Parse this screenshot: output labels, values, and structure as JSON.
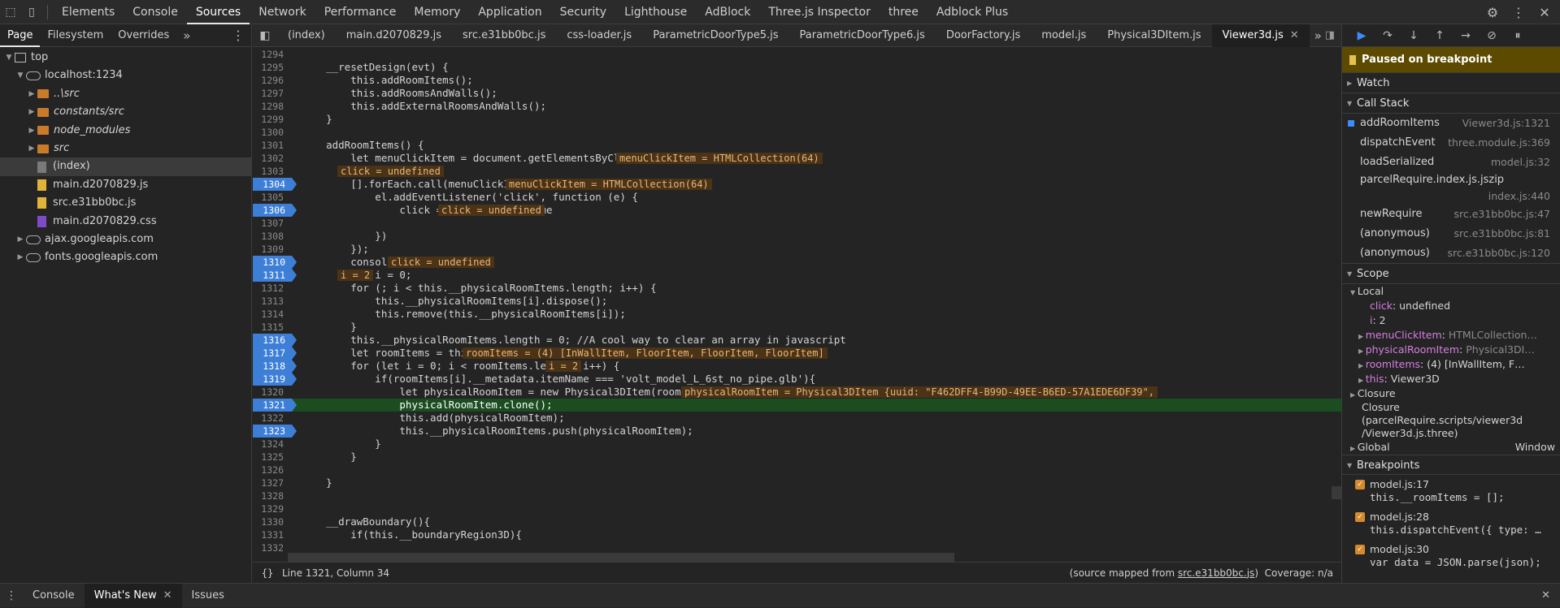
{
  "top_tabs": [
    "Elements",
    "Console",
    "Sources",
    "Network",
    "Performance",
    "Memory",
    "Application",
    "Security",
    "Lighthouse",
    "AdBlock",
    "Three.js Inspector",
    "three",
    "Adblock Plus"
  ],
  "active_top_tab": "Sources",
  "nav_tabs": [
    "Page",
    "Filesystem",
    "Overrides"
  ],
  "tree": {
    "top": "top",
    "localhost": "localhost:1234",
    "folders": [
      "..\\src",
      "constants/src",
      "node_modules",
      "src"
    ],
    "index": "(index)",
    "files": [
      "main.d2070829.js",
      "src.e31bb0bc.js",
      "main.d2070829.css"
    ],
    "ajax": "ajax.googleapis.com",
    "fonts": "fonts.googleapis.com"
  },
  "editor_tabs": [
    "(index)",
    "main.d2070829.js",
    "src.e31bb0bc.js",
    "css-loader.js",
    "ParametricDoorType5.js",
    "ParametricDoorType6.js",
    "DoorFactory.js",
    "model.js",
    "Physical3DItem.js",
    "Viewer3d.js"
  ],
  "active_editor_tab": "Viewer3d.js",
  "code_lines": [
    {
      "n": "1294",
      "t": "",
      "bp": false
    },
    {
      "n": "1295",
      "t": "    __resetDesign(evt) {",
      "bp": false
    },
    {
      "n": "1296",
      "t": "        this.addRoomItems();",
      "bp": false
    },
    {
      "n": "1297",
      "t": "        this.addRoomsAndWalls();",
      "bp": false
    },
    {
      "n": "1298",
      "t": "        this.addExternalRoomsAndWalls();",
      "bp": false
    },
    {
      "n": "1299",
      "t": "    }",
      "bp": false
    },
    {
      "n": "1300",
      "t": "",
      "bp": false
    },
    {
      "n": "1301",
      "t": "    addRoomItems() {",
      "bp": false
    },
    {
      "n": "1302",
      "t": "        let menuClickItem = document.getElementsByClassName(\"sub-menu-item\");",
      "bp": false,
      "inline": "menuClickItem = HTMLCollection(64)",
      "ix": 758
    },
    {
      "n": "1303",
      "t": "        let click;",
      "bp": false,
      "inline": "click = undefined",
      "ix": 415
    },
    {
      "n": "1304",
      "t": "        [].forEach.call(menuClickItem,function(el){",
      "bp": true,
      "inline": "menuClickItem = HTMLCollection(64)",
      "ix": 622
    },
    {
      "n": "1305",
      "t": "            el.addEventListener('click', function (e) {",
      "bp": false
    },
    {
      "n": "1306",
      "t": "                click = this.dataset.name",
      "bp": true,
      "inline": "click = undefined",
      "ix": 539
    },
    {
      "n": "1307",
      "t": "",
      "bp": false
    },
    {
      "n": "1308",
      "t": "            })",
      "bp": false
    },
    {
      "n": "1309",
      "t": "        });",
      "bp": false
    },
    {
      "n": "1310",
      "t": "        console.log(click)",
      "bp": true,
      "inline": "click = undefined",
      "ix": 477
    },
    {
      "n": "1311",
      "t": "        let i = 0;",
      "bp": true,
      "inline": "i = 2",
      "ix": 415
    },
    {
      "n": "1312",
      "t": "        for (; i < this.__physicalRoomItems.length; i++) {",
      "bp": false
    },
    {
      "n": "1313",
      "t": "            this.__physicalRoomItems[i].dispose();",
      "bp": false
    },
    {
      "n": "1314",
      "t": "            this.remove(this.__physicalRoomItems[i]);",
      "bp": false
    },
    {
      "n": "1315",
      "t": "        }",
      "bp": false
    },
    {
      "n": "1316",
      "t": "        this.__physicalRoomItems.length = 0; //A cool way to clear an array in javascript",
      "bp": true
    },
    {
      "n": "1317",
      "t": "        let roomItems = this.model.roomItems;",
      "bp": true,
      "inline": "roomItems = (4) [InWallItem, FloorItem, FloorItem, FloorItem]",
      "ix": 569
    },
    {
      "n": "1318",
      "t": "        for (let i = 0; i < roomItems.length; i++) {",
      "bp": true,
      "inline": "i = 2",
      "ix": 671
    },
    {
      "n": "1319",
      "t": "            if(roomItems[i].__metadata.itemName === 'volt_model_L_6st_no_pipe.glb'){",
      "bp": true
    },
    {
      "n": "1320",
      "t": "                let physicalRoomItem = new Physical3DItem(roomItems[i], this.__options);",
      "bp": false,
      "inline": "physicalRoomItem = Physical3DItem {uuid: \"F462DFF4-B99D-49EE-B6ED-57A1EDE6DF39\",",
      "ix": 838
    },
    {
      "n": "1321",
      "t": "                physicalRoomItem.clone();",
      "bp": true,
      "exec": true
    },
    {
      "n": "1322",
      "t": "                this.add(physicalRoomItem);",
      "bp": false
    },
    {
      "n": "1323",
      "t": "                this.__physicalRoomItems.push(physicalRoomItem);",
      "bp": true
    },
    {
      "n": "1324",
      "t": "            }",
      "bp": false
    },
    {
      "n": "1325",
      "t": "        }",
      "bp": false
    },
    {
      "n": "1326",
      "t": "",
      "bp": false
    },
    {
      "n": "1327",
      "t": "    }",
      "bp": false
    },
    {
      "n": "1328",
      "t": "",
      "bp": false
    },
    {
      "n": "1329",
      "t": "",
      "bp": false
    },
    {
      "n": "1330",
      "t": "    __drawBoundary(){",
      "bp": false
    },
    {
      "n": "1331",
      "t": "        if(this.__boundaryRegion3D){",
      "bp": false
    },
    {
      "n": "1332",
      "t": "",
      "bp": false
    }
  ],
  "status": {
    "braces": "{}",
    "position": "Line 1321, Column 34",
    "source_mapped_prefix": "(source mapped from ",
    "source_mapped_link": "src.e31bb0bc.js",
    "source_mapped_suffix": ")",
    "coverage": "Coverage: n/a"
  },
  "debugger": {
    "paused": "Paused on breakpoint",
    "watch": "Watch",
    "call_stack": "Call Stack",
    "frames": [
      {
        "name": "addRoomItems",
        "loc": "Viewer3d.js:1321",
        "current": true
      },
      {
        "name": "dispatchEvent",
        "loc": "three.module.js:369"
      },
      {
        "name": "loadSerialized",
        "loc": "model.js:32"
      },
      {
        "name": "parcelRequire.index.js.jszip",
        "loc": "index.js:440",
        "two": true
      },
      {
        "name": "newRequire",
        "loc": "src.e31bb0bc.js:47"
      },
      {
        "name": "(anonymous)",
        "loc": "src.e31bb0bc.js:81"
      },
      {
        "name": "(anonymous)",
        "loc": "src.e31bb0bc.js:120"
      }
    ],
    "scope": "Scope",
    "local": "Local",
    "locals": [
      {
        "k": "click",
        "v": "undefined",
        "plain": true
      },
      {
        "k": "i",
        "v": "2",
        "plain": true
      },
      {
        "k": "menuClickItem",
        "v": "HTMLCollection…",
        "gray": true
      },
      {
        "k": "physicalRoomItem",
        "v": "Physical3DI…",
        "gray": true
      },
      {
        "k": "roomItems",
        "v": "(4) [InWallItem, F…"
      },
      {
        "k": "this",
        "v": "Viewer3D"
      }
    ],
    "closure": "Closure",
    "closure2": "Closure\n(parcelRequire.scripts/viewer3d\n/Viewer3d.js.three)",
    "global": "Global",
    "global_val": "Window",
    "breakpoints": "Breakpoints",
    "bps": [
      {
        "loc": "model.js:17",
        "code": "this.__roomItems = [];"
      },
      {
        "loc": "model.js:28",
        "code": "this.dispatchEvent({ type: …"
      },
      {
        "loc": "model.js:30",
        "code": "var data = JSON.parse(json);"
      }
    ]
  },
  "drawer_tabs": [
    "Console",
    "What's New",
    "Issues"
  ],
  "active_drawer_tab": "What's New"
}
